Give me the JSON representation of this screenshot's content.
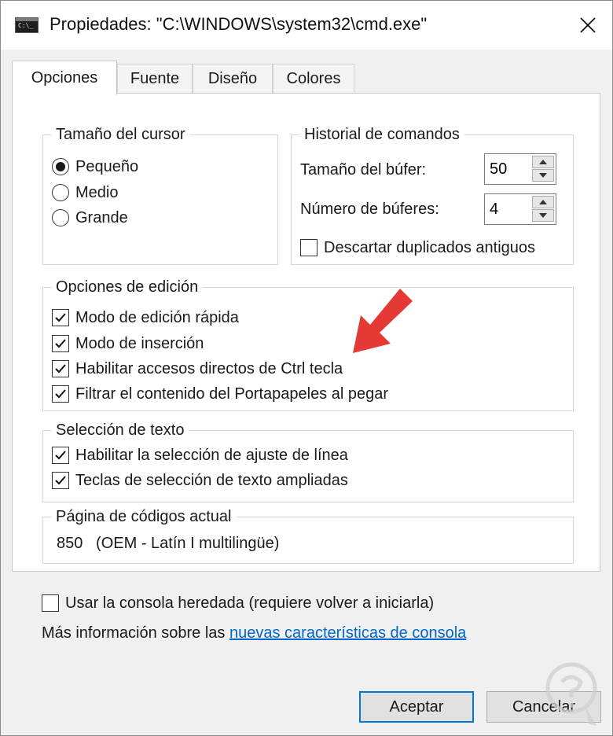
{
  "window": {
    "title": "Propiedades: \"C:\\WINDOWS\\system32\\cmd.exe\"",
    "icon_label": "C:\\_"
  },
  "tabs": [
    {
      "label": "Opciones",
      "active": true
    },
    {
      "label": "Fuente",
      "active": false
    },
    {
      "label": "Diseño",
      "active": false
    },
    {
      "label": "Colores",
      "active": false
    }
  ],
  "cursor_size": {
    "legend": "Tamaño del cursor",
    "options": [
      {
        "label": "Pequeño",
        "selected": true
      },
      {
        "label": "Medio",
        "selected": false
      },
      {
        "label": "Grande",
        "selected": false
      }
    ]
  },
  "command_history": {
    "legend": "Historial de comandos",
    "buffer_size_label": "Tamaño del búfer:",
    "buffer_size_value": "50",
    "buffer_count_label": "Número de búferes:",
    "buffer_count_value": "4",
    "discard_duplicates_label": "Descartar duplicados antiguos",
    "discard_duplicates_checked": false
  },
  "edit_options": {
    "legend": "Opciones de edición",
    "items": [
      {
        "label": "Modo de edición rápida",
        "checked": true
      },
      {
        "label": "Modo de inserción",
        "checked": true
      },
      {
        "label": "Habilitar accesos directos de Ctrl tecla",
        "checked": true
      },
      {
        "label": "Filtrar el contenido del Portapapeles al pegar",
        "checked": true
      }
    ]
  },
  "text_selection": {
    "legend": "Selección de texto",
    "items": [
      {
        "label": "Habilitar la selección de ajuste de línea",
        "checked": true
      },
      {
        "label": "Teclas de selección de texto ampliadas",
        "checked": true
      }
    ]
  },
  "code_page": {
    "legend": "Página de códigos actual",
    "value": "850   (OEM - Latín I multilingüe)"
  },
  "legacy_console": {
    "label": "Usar la consola heredada (requiere volver a iniciarla)",
    "checked": false
  },
  "more_info": {
    "text": "Más información sobre las ",
    "link_text": "nuevas características de consola"
  },
  "buttons": {
    "ok": "Aceptar",
    "cancel": "Cancelar"
  },
  "colors": {
    "accent": "#0078d7",
    "link": "#0066cc",
    "annotation_arrow": "#e53935"
  }
}
